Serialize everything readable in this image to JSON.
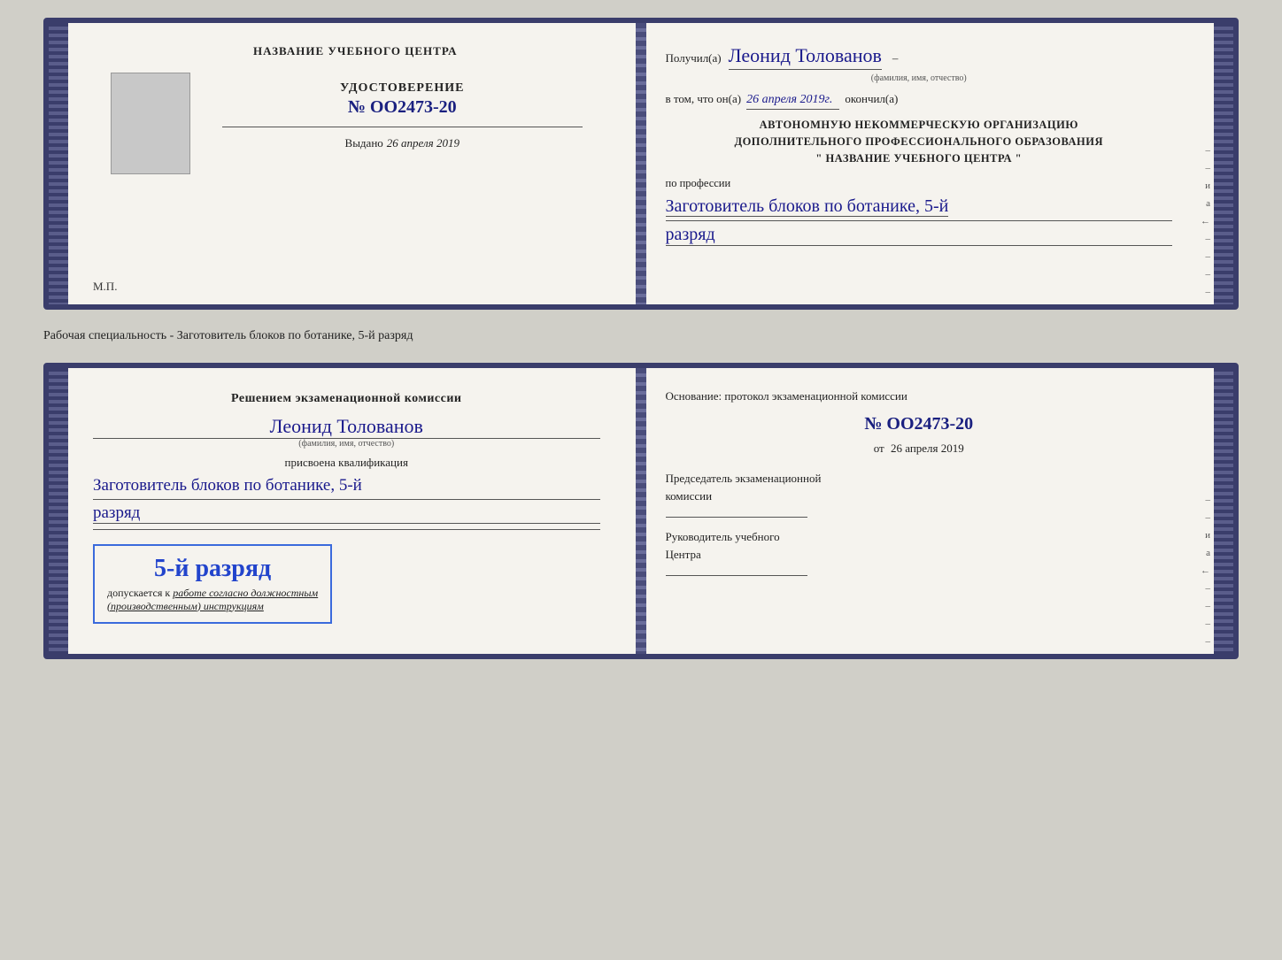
{
  "card1": {
    "left": {
      "header": "НАЗВАНИЕ УЧЕБНОГО ЦЕНТРА",
      "udostoverenie_title": "УДОСТОВЕРЕНИЕ",
      "number": "№ OO2473-20",
      "vydano_label": "Выдано",
      "vydano_date": "26 апреля 2019",
      "mp_label": "М.П."
    },
    "right": {
      "poluchil_label": "Получил(а)",
      "name": "Леонид Толованов",
      "fio_label": "(фамилия, имя, отчество)",
      "vtom_prefix": "в том, что он(а)",
      "date_handwritten": "26 апреля 2019г.",
      "okончил_label": "окончил(а)",
      "org_line1": "АВТОНОМНУЮ НЕКОММЕРЧЕСКУЮ ОРГАНИЗАЦИЮ",
      "org_line2": "ДОПОЛНИТЕЛЬНОГО ПРОФЕССИОНАЛЬНОГО ОБРАЗОВАНИЯ",
      "org_quote1": "\"",
      "org_name": "НАЗВАНИЕ УЧЕБНОГО ЦЕНТРА",
      "org_quote2": "\"",
      "po_professii": "по профессии",
      "profession": "Заготовитель блоков по ботанике, 5-й",
      "razryad": "разряд"
    }
  },
  "caption": "Рабочая специальность - Заготовитель блоков по ботанике, 5-й разряд",
  "card2": {
    "left": {
      "decision_line1": "Решением экзаменационной комиссии",
      "name": "Леонид Толованов",
      "fio_label": "(фамилия, имя, отчество)",
      "prisvoena": "присвоена квалификация",
      "qualification": "Заготовитель блоков по ботанике, 5-й",
      "razryad": "разряд",
      "stamp_text": "5-й разряд",
      "dopuskaetsya": "допускается к",
      "rabote": "работе согласно должностным",
      "instruktsiyam": "(производственным) инструкциям"
    },
    "right": {
      "osnovaniye": "Основание: протокол экзаменационной комиссии",
      "number": "№ OO2473-20",
      "ot_prefix": "от",
      "ot_date": "26 апреля 2019",
      "predsedatel_line1": "Председатель экзаменационной",
      "predsedatel_line2": "комиссии",
      "rukovoditel_line1": "Руководитель учебного",
      "rukovoditel_line2": "Центра"
    }
  },
  "side_dashes": [
    "-",
    "-",
    "–",
    "и",
    "а",
    "←",
    "-",
    "-",
    "-",
    "-"
  ]
}
